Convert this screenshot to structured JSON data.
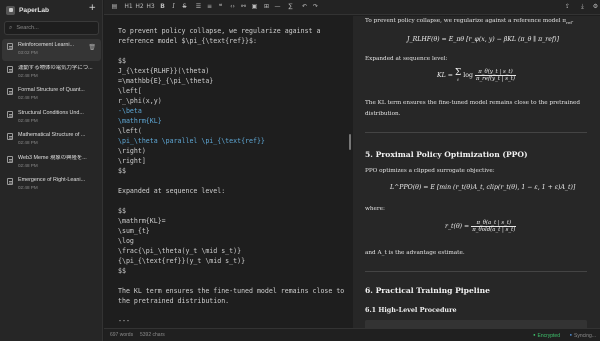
{
  "app": {
    "name": "PaperLab"
  },
  "sidebar": {
    "search_placeholder": "Search...",
    "documents": [
      {
        "title": "Reinforcement Learni...",
        "time": "03:02 PM",
        "active": true
      },
      {
        "title": "運動する物体の電気力学につ...",
        "time": "02:48 PM"
      },
      {
        "title": "Formal Structure of Quant...",
        "time": "02:48 PM"
      },
      {
        "title": "Structural Conditions Und...",
        "time": "02:48 PM"
      },
      {
        "title": "Mathematical Structure of ...",
        "time": "02:48 PM"
      },
      {
        "title": "Web3 Meme 現象の興隆を...",
        "time": "02:48 PM"
      },
      {
        "title": "Emergence of Right-Leani...",
        "time": "02:48 PM"
      }
    ]
  },
  "toolbar": {
    "buttons": [
      {
        "name": "sidebar-toggle-icon",
        "glyph": "▤"
      },
      {
        "name": "heading1-button",
        "glyph": "H1"
      },
      {
        "name": "heading2-button",
        "glyph": "H2"
      },
      {
        "name": "heading3-button",
        "glyph": "H3"
      },
      {
        "name": "bold-button",
        "glyph": "B"
      },
      {
        "name": "italic-button",
        "glyph": "I"
      },
      {
        "name": "strikethrough-button",
        "glyph": "S"
      },
      {
        "name": "bullet-list-icon",
        "glyph": "☰"
      },
      {
        "name": "numbered-list-icon",
        "glyph": "≡"
      },
      {
        "name": "quote-icon",
        "glyph": "❝"
      },
      {
        "name": "code-icon",
        "glyph": "‹›"
      },
      {
        "name": "link-icon",
        "glyph": "⚯"
      },
      {
        "name": "image-icon",
        "glyph": "▣"
      },
      {
        "name": "table-icon",
        "glyph": "⊞"
      },
      {
        "name": "divider-icon",
        "glyph": "—"
      },
      {
        "name": "math-icon",
        "glyph": "∑"
      },
      {
        "name": "undo-icon",
        "glyph": "↶"
      },
      {
        "name": "redo-icon",
        "glyph": "↷"
      }
    ]
  },
  "editor": {
    "lines": [
      {
        "t": ""
      },
      {
        "t": "To prevent policy collapse, we regularize against a"
      },
      {
        "t": "reference model $\\pi_{\\text{ref}}$:"
      },
      {
        "t": ""
      },
      {
        "t": "$$"
      },
      {
        "t": "J_{\\text{RLHF}}(\\theta)"
      },
      {
        "t": "=\\mathbb{E}_{\\pi_\\theta}"
      },
      {
        "t": "\\left["
      },
      {
        "t": "r_\\phi(x,y)"
      },
      {
        "t": "-\\beta",
        "c": true
      },
      {
        "t": "\\mathrm{KL}",
        "c": true
      },
      {
        "t": "\\left("
      },
      {
        "t": "\\pi_\\theta \\parallel \\pi_{\\text{ref}}",
        "c": true
      },
      {
        "t": "\\right)"
      },
      {
        "t": "\\right]"
      },
      {
        "t": "$$"
      },
      {
        "t": ""
      },
      {
        "t": "Expanded at sequence level:"
      },
      {
        "t": ""
      },
      {
        "t": "$$"
      },
      {
        "t": "\\mathrm{KL}="
      },
      {
        "t": "\\sum_{t}"
      },
      {
        "t": "\\log"
      },
      {
        "t": "\\frac{\\pi_\\theta(y_t \\mid s_t)}"
      },
      {
        "t": "{\\pi_{\\text{ref}}(y_t \\mid s_t)}"
      },
      {
        "t": "$$"
      },
      {
        "t": ""
      },
      {
        "t": "The KL term ensures the fine-tuned model remains close to"
      },
      {
        "t": "the pretrained distribution."
      },
      {
        "t": ""
      },
      {
        "t": "---"
      }
    ]
  },
  "preview": {
    "p1": "To prevent policy collapse, we regularize against a reference model π",
    "p1_sub": "ref",
    "eq1": "J_RLHF(θ) = E_πθ [r_φ(x, y) − βKL (π_θ ∥ π_ref)]",
    "p2": "Expanded at sequence level:",
    "eq2_left": "KL = ",
    "eq2_sum": "Σ",
    "eq2_sum_sub": "t",
    "eq2_log": "log",
    "eq2_num": "π_θ(y_t | s_t)",
    "eq2_den": "π_ref(y_t | s_t)",
    "p3a": "The KL term ensures the fine-tuned model remains close to the pretrained",
    "p3b": "distribution.",
    "h_ppo": "5. Proximal Policy Optimization (PPO)",
    "p4": "PPO optimizes a clipped surrogate objective:",
    "eq3": "L^PPO(θ) = E [min (r_t(θ)A_t, clip(r_t(θ), 1 − ε, 1 + ε)A_t)]",
    "p5": "where:",
    "eq4_left": "r_t(θ) = ",
    "eq4_num": "π_θ(a_t | s_t)",
    "eq4_den": "π_θold(a_t | s_t)",
    "p6": "and A_t is the advantage estimate.",
    "h_pipeline": "6. Practical Training Pipeline",
    "h_procedure": "6.1 High-Level Procedure"
  },
  "status": {
    "words": "697 words",
    "chars": "5392 chars",
    "encrypted": "Encrypted",
    "syncing": "Syncing..."
  },
  "colors": {
    "accent_green": "#3ec46d",
    "latex_blue": "#5fa8d6"
  }
}
